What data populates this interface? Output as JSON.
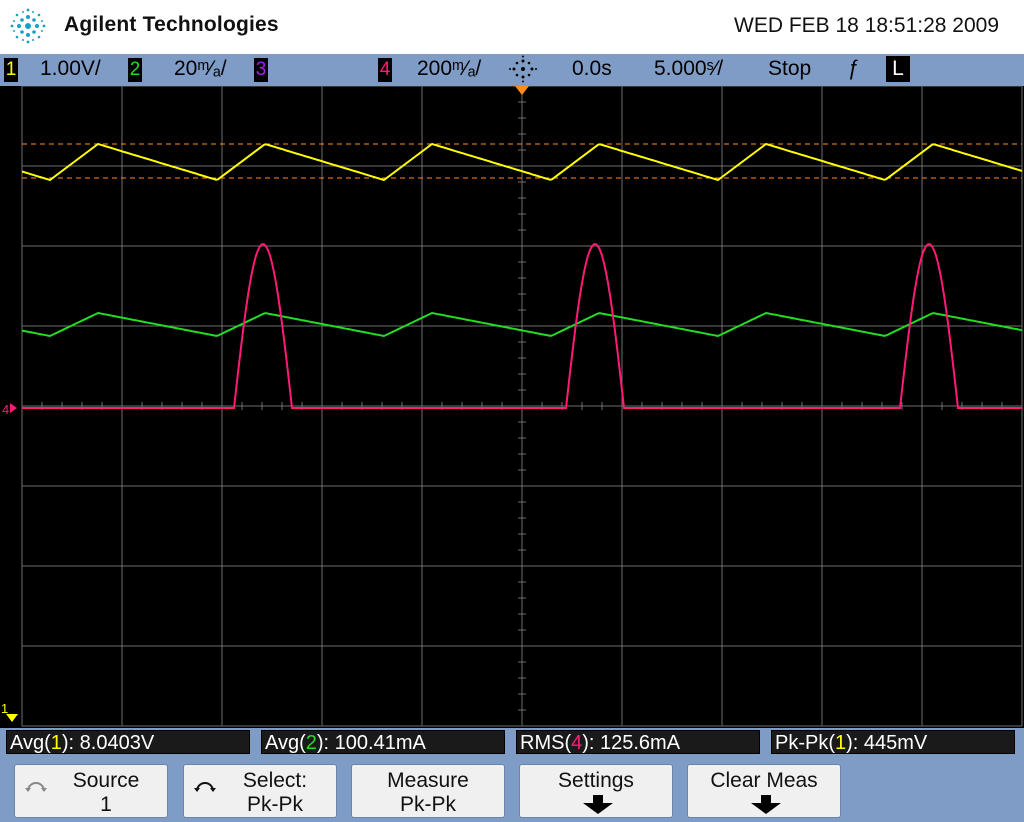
{
  "header": {
    "brand": "Agilent Technologies",
    "datetime": "WED FEB 18 18:51:28 2009"
  },
  "status": {
    "ch1": {
      "num": "1",
      "scale": "1.00V/",
      "color": "#ffff00"
    },
    "ch2": {
      "num": "2",
      "scale": "20ᵐ⁄ₐ/",
      "color": "#22dd22"
    },
    "ch3": {
      "num": "3",
      "color": "#a020f0"
    },
    "ch4": {
      "num": "4",
      "scale": "200ᵐ⁄ₐ/",
      "color": "#ff1a75"
    },
    "delay": "0.0s",
    "timebase": "5.000ˢ⁄/",
    "run_state": "Stop",
    "trigger_slope": "ƒ",
    "trigger_mode": "L"
  },
  "measurements": [
    {
      "prefix": "Avg(",
      "ch": "1",
      "suffix": "): 8.0403V",
      "color": "#ffff00"
    },
    {
      "prefix": "Avg(",
      "ch": "2",
      "suffix": "): 100.41mA",
      "color": "#22dd22"
    },
    {
      "prefix": "RMS(",
      "ch": "4",
      "suffix": "): 125.6mA",
      "color": "#ff1a75"
    },
    {
      "prefix": "Pk-Pk(",
      "ch": "1",
      "suffix": "): 445mV",
      "color": "#ffff00"
    }
  ],
  "softkeys": [
    {
      "line1": "Source",
      "line2": "1",
      "icon": "rotate-knob-icon"
    },
    {
      "line1": "Select:",
      "line2": "Pk-Pk",
      "icon": "rotate-knob-icon"
    },
    {
      "line1": "Measure",
      "line2": "Pk-Pk"
    },
    {
      "line1": "Settings",
      "line2": "",
      "icon": "down-arrow-icon"
    },
    {
      "line1": "Clear Meas",
      "line2": "",
      "icon": "down-arrow-icon"
    }
  ],
  "screen": {
    "ch4_marker": "4",
    "ch12_marker": "1"
  },
  "colors": {
    "ch1": "#ffff00",
    "ch2": "#22dd22",
    "ch4": "#ff1a75",
    "grid": "#6e6e6e",
    "cursor": "#ff8c1a",
    "frame": "#7f9cc6"
  }
}
